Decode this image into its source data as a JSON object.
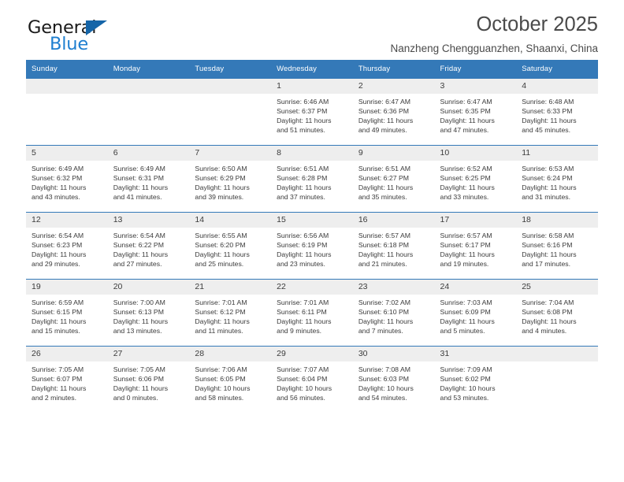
{
  "brand": {
    "name_part1": "General",
    "name_part2": "Blue",
    "accent_color": "#1f7fd0",
    "triangle_color": "#1565a8"
  },
  "header": {
    "title": "October 2025",
    "subtitle": "Nanzheng Chengguanzhen, Shaanxi, China"
  },
  "theme": {
    "header_bg": "#3479b8",
    "daynum_bg": "#eeeeee",
    "text_color": "#3b3b3b"
  },
  "weekday_headers": [
    "Sunday",
    "Monday",
    "Tuesday",
    "Wednesday",
    "Thursday",
    "Friday",
    "Saturday"
  ],
  "weeks": [
    [
      {
        "day": "",
        "sunrise": "",
        "sunset": "",
        "daylight1": "",
        "daylight2": ""
      },
      {
        "day": "",
        "sunrise": "",
        "sunset": "",
        "daylight1": "",
        "daylight2": ""
      },
      {
        "day": "",
        "sunrise": "",
        "sunset": "",
        "daylight1": "",
        "daylight2": ""
      },
      {
        "day": "1",
        "sunrise": "Sunrise: 6:46 AM",
        "sunset": "Sunset: 6:37 PM",
        "daylight1": "Daylight: 11 hours",
        "daylight2": "and 51 minutes."
      },
      {
        "day": "2",
        "sunrise": "Sunrise: 6:47 AM",
        "sunset": "Sunset: 6:36 PM",
        "daylight1": "Daylight: 11 hours",
        "daylight2": "and 49 minutes."
      },
      {
        "day": "3",
        "sunrise": "Sunrise: 6:47 AM",
        "sunset": "Sunset: 6:35 PM",
        "daylight1": "Daylight: 11 hours",
        "daylight2": "and 47 minutes."
      },
      {
        "day": "4",
        "sunrise": "Sunrise: 6:48 AM",
        "sunset": "Sunset: 6:33 PM",
        "daylight1": "Daylight: 11 hours",
        "daylight2": "and 45 minutes."
      }
    ],
    [
      {
        "day": "5",
        "sunrise": "Sunrise: 6:49 AM",
        "sunset": "Sunset: 6:32 PM",
        "daylight1": "Daylight: 11 hours",
        "daylight2": "and 43 minutes."
      },
      {
        "day": "6",
        "sunrise": "Sunrise: 6:49 AM",
        "sunset": "Sunset: 6:31 PM",
        "daylight1": "Daylight: 11 hours",
        "daylight2": "and 41 minutes."
      },
      {
        "day": "7",
        "sunrise": "Sunrise: 6:50 AM",
        "sunset": "Sunset: 6:29 PM",
        "daylight1": "Daylight: 11 hours",
        "daylight2": "and 39 minutes."
      },
      {
        "day": "8",
        "sunrise": "Sunrise: 6:51 AM",
        "sunset": "Sunset: 6:28 PM",
        "daylight1": "Daylight: 11 hours",
        "daylight2": "and 37 minutes."
      },
      {
        "day": "9",
        "sunrise": "Sunrise: 6:51 AM",
        "sunset": "Sunset: 6:27 PM",
        "daylight1": "Daylight: 11 hours",
        "daylight2": "and 35 minutes."
      },
      {
        "day": "10",
        "sunrise": "Sunrise: 6:52 AM",
        "sunset": "Sunset: 6:25 PM",
        "daylight1": "Daylight: 11 hours",
        "daylight2": "and 33 minutes."
      },
      {
        "day": "11",
        "sunrise": "Sunrise: 6:53 AM",
        "sunset": "Sunset: 6:24 PM",
        "daylight1": "Daylight: 11 hours",
        "daylight2": "and 31 minutes."
      }
    ],
    [
      {
        "day": "12",
        "sunrise": "Sunrise: 6:54 AM",
        "sunset": "Sunset: 6:23 PM",
        "daylight1": "Daylight: 11 hours",
        "daylight2": "and 29 minutes."
      },
      {
        "day": "13",
        "sunrise": "Sunrise: 6:54 AM",
        "sunset": "Sunset: 6:22 PM",
        "daylight1": "Daylight: 11 hours",
        "daylight2": "and 27 minutes."
      },
      {
        "day": "14",
        "sunrise": "Sunrise: 6:55 AM",
        "sunset": "Sunset: 6:20 PM",
        "daylight1": "Daylight: 11 hours",
        "daylight2": "and 25 minutes."
      },
      {
        "day": "15",
        "sunrise": "Sunrise: 6:56 AM",
        "sunset": "Sunset: 6:19 PM",
        "daylight1": "Daylight: 11 hours",
        "daylight2": "and 23 minutes."
      },
      {
        "day": "16",
        "sunrise": "Sunrise: 6:57 AM",
        "sunset": "Sunset: 6:18 PM",
        "daylight1": "Daylight: 11 hours",
        "daylight2": "and 21 minutes."
      },
      {
        "day": "17",
        "sunrise": "Sunrise: 6:57 AM",
        "sunset": "Sunset: 6:17 PM",
        "daylight1": "Daylight: 11 hours",
        "daylight2": "and 19 minutes."
      },
      {
        "day": "18",
        "sunrise": "Sunrise: 6:58 AM",
        "sunset": "Sunset: 6:16 PM",
        "daylight1": "Daylight: 11 hours",
        "daylight2": "and 17 minutes."
      }
    ],
    [
      {
        "day": "19",
        "sunrise": "Sunrise: 6:59 AM",
        "sunset": "Sunset: 6:15 PM",
        "daylight1": "Daylight: 11 hours",
        "daylight2": "and 15 minutes."
      },
      {
        "day": "20",
        "sunrise": "Sunrise: 7:00 AM",
        "sunset": "Sunset: 6:13 PM",
        "daylight1": "Daylight: 11 hours",
        "daylight2": "and 13 minutes."
      },
      {
        "day": "21",
        "sunrise": "Sunrise: 7:01 AM",
        "sunset": "Sunset: 6:12 PM",
        "daylight1": "Daylight: 11 hours",
        "daylight2": "and 11 minutes."
      },
      {
        "day": "22",
        "sunrise": "Sunrise: 7:01 AM",
        "sunset": "Sunset: 6:11 PM",
        "daylight1": "Daylight: 11 hours",
        "daylight2": "and 9 minutes."
      },
      {
        "day": "23",
        "sunrise": "Sunrise: 7:02 AM",
        "sunset": "Sunset: 6:10 PM",
        "daylight1": "Daylight: 11 hours",
        "daylight2": "and 7 minutes."
      },
      {
        "day": "24",
        "sunrise": "Sunrise: 7:03 AM",
        "sunset": "Sunset: 6:09 PM",
        "daylight1": "Daylight: 11 hours",
        "daylight2": "and 5 minutes."
      },
      {
        "day": "25",
        "sunrise": "Sunrise: 7:04 AM",
        "sunset": "Sunset: 6:08 PM",
        "daylight1": "Daylight: 11 hours",
        "daylight2": "and 4 minutes."
      }
    ],
    [
      {
        "day": "26",
        "sunrise": "Sunrise: 7:05 AM",
        "sunset": "Sunset: 6:07 PM",
        "daylight1": "Daylight: 11 hours",
        "daylight2": "and 2 minutes."
      },
      {
        "day": "27",
        "sunrise": "Sunrise: 7:05 AM",
        "sunset": "Sunset: 6:06 PM",
        "daylight1": "Daylight: 11 hours",
        "daylight2": "and 0 minutes."
      },
      {
        "day": "28",
        "sunrise": "Sunrise: 7:06 AM",
        "sunset": "Sunset: 6:05 PM",
        "daylight1": "Daylight: 10 hours",
        "daylight2": "and 58 minutes."
      },
      {
        "day": "29",
        "sunrise": "Sunrise: 7:07 AM",
        "sunset": "Sunset: 6:04 PM",
        "daylight1": "Daylight: 10 hours",
        "daylight2": "and 56 minutes."
      },
      {
        "day": "30",
        "sunrise": "Sunrise: 7:08 AM",
        "sunset": "Sunset: 6:03 PM",
        "daylight1": "Daylight: 10 hours",
        "daylight2": "and 54 minutes."
      },
      {
        "day": "31",
        "sunrise": "Sunrise: 7:09 AM",
        "sunset": "Sunset: 6:02 PM",
        "daylight1": "Daylight: 10 hours",
        "daylight2": "and 53 minutes."
      },
      {
        "day": "",
        "sunrise": "",
        "sunset": "",
        "daylight1": "",
        "daylight2": ""
      }
    ]
  ]
}
